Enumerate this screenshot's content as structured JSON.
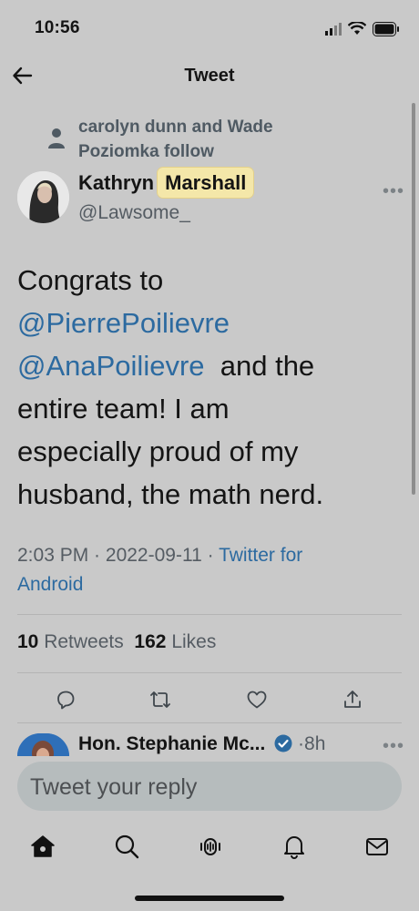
{
  "status_bar": {
    "time": "10:56"
  },
  "header": {
    "title": "Tweet"
  },
  "social_context": {
    "text_line1": "carolyn dunn and Wade",
    "text_line2": "Poziomka follow"
  },
  "author": {
    "first_name": "Kathryn",
    "last_name": "Marshall",
    "handle": "@Lawsome_"
  },
  "tweet": {
    "line1": "Congrats to",
    "mention1": "@PierrePoilievre",
    "mention2": "@AnaPoilievre",
    "line3_after": "  and the",
    "line4": "entire team! I am",
    "line5": "especially proud of my",
    "line6": "husband, the math nerd."
  },
  "meta": {
    "time": "2:03 PM",
    "date": "2022-09-11",
    "source_line1": "Twitter for",
    "source_line2": "Android"
  },
  "stats": {
    "retweets_count": "10",
    "retweets_label": "Retweets",
    "likes_count": "162",
    "likes_label": "Likes"
  },
  "reply": {
    "name": "Hon. Stephanie Mc...",
    "time": "·8h"
  },
  "composer": {
    "placeholder": "Tweet your reply"
  },
  "icons": [
    "back-arrow-icon",
    "person-icon",
    "more-icon",
    "reply-icon",
    "retweet-icon",
    "like-icon",
    "share-icon",
    "verified-icon",
    "home-icon",
    "search-icon",
    "spaces-icon",
    "notifications-icon",
    "messages-icon"
  ]
}
